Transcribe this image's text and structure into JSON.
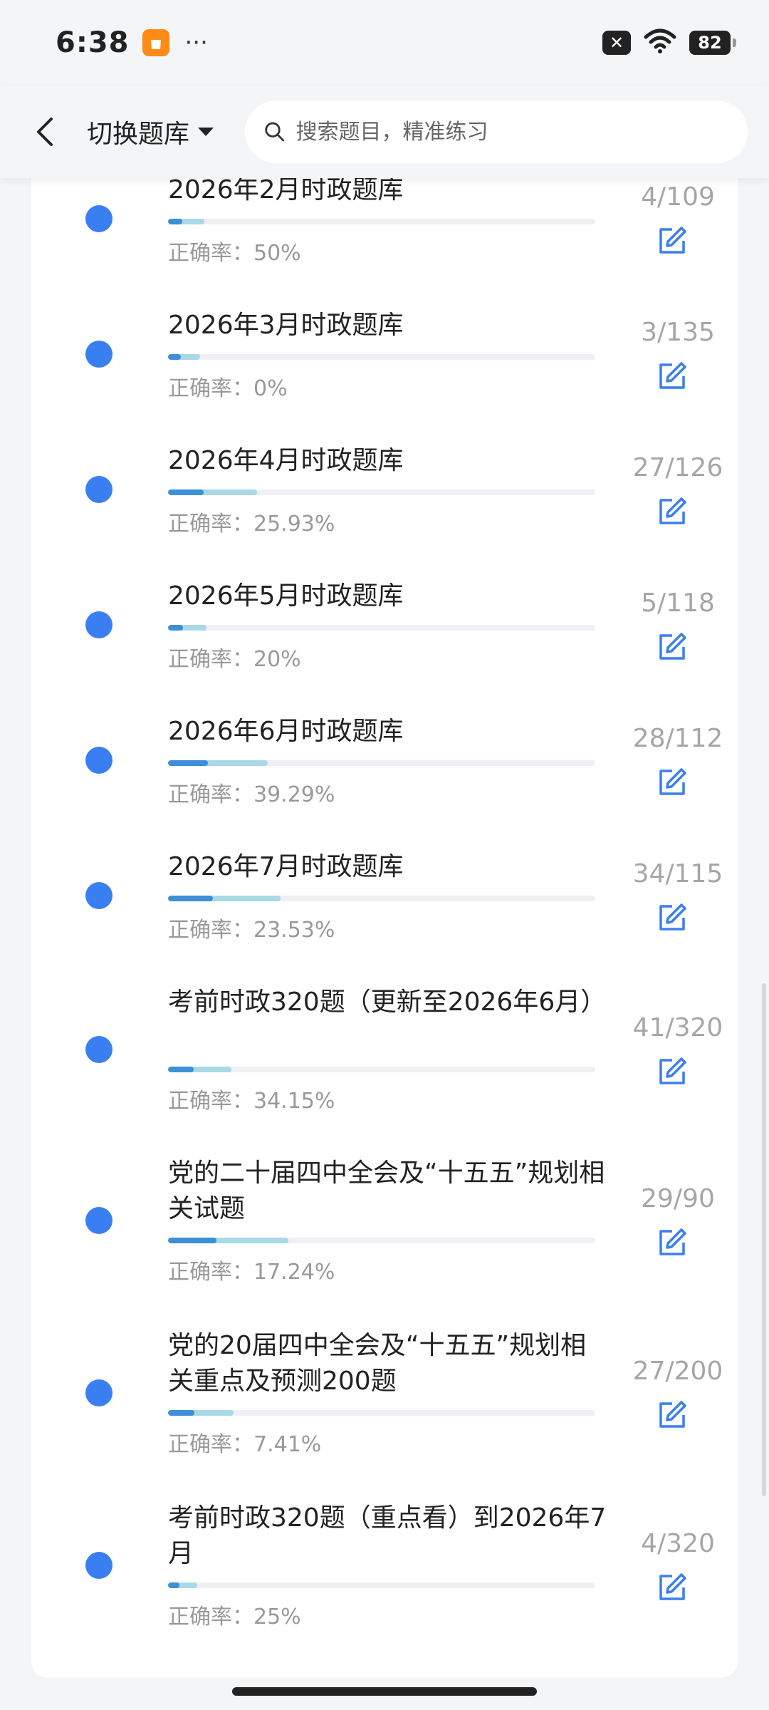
{
  "status_bar": {
    "time": "6:38",
    "battery": "82",
    "icons": [
      "shopping-bag-icon",
      "more-icon",
      "mute-icon",
      "wifi-icon",
      "battery-icon"
    ]
  },
  "header": {
    "back_icon": "chevron-left-icon",
    "switch_label": "切换题库",
    "search_placeholder": "搜索题目，精准练习"
  },
  "colors": {
    "dot": "#3a7ff2",
    "progress_done": "#3d8fd6",
    "progress_total": "#a9d8e6",
    "edit_icon": "#3a7ff2"
  },
  "items": [
    {
      "title": "2026年2月时政题库",
      "accuracy": "正确率：50%",
      "count": "4/109",
      "done": 4,
      "total": 109
    },
    {
      "title": "2026年3月时政题库",
      "accuracy": "正确率：0%",
      "count": "3/135",
      "done": 3,
      "total": 135
    },
    {
      "title": "2026年4月时政题库",
      "accuracy": "正确率：25.93%",
      "count": "27/126",
      "done": 27,
      "total": 126
    },
    {
      "title": "2026年5月时政题库",
      "accuracy": "正确率：20%",
      "count": "5/118",
      "done": 5,
      "total": 118
    },
    {
      "title": "2026年6月时政题库",
      "accuracy": "正确率：39.29%",
      "count": "28/112",
      "done": 28,
      "total": 112
    },
    {
      "title": "2026年7月时政题库",
      "accuracy": "正确率：23.53%",
      "count": "34/115",
      "done": 34,
      "total": 115
    },
    {
      "title": "考前时政320题（更新至2026年6月）",
      "accuracy": "正确率：34.15%",
      "count": "41/320",
      "done": 41,
      "total": 320
    },
    {
      "title": "党的二十届四中全会及“十五五”规划相关试题",
      "accuracy": "正确率：17.24%",
      "count": "29/90",
      "done": 29,
      "total": 90
    },
    {
      "title": "党的20届四中全会及“十五五”规划相关重点及预测200题",
      "accuracy": "正确率：7.41%",
      "count": "27/200",
      "done": 27,
      "total": 200
    },
    {
      "title": "考前时政320题（重点看）到2026年7月",
      "accuracy": "正确率：25%",
      "count": "4/320",
      "done": 4,
      "total": 320
    }
  ]
}
